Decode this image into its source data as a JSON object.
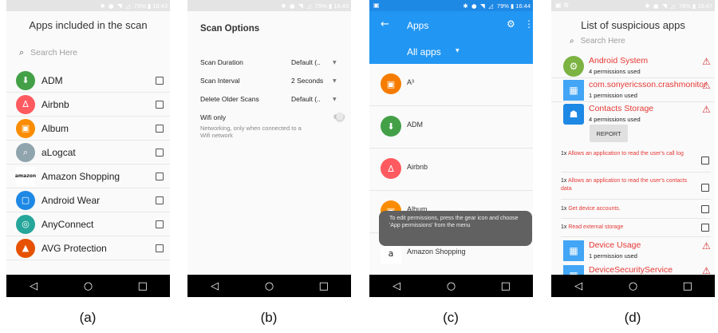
{
  "panel_a": {
    "status_text": "79% ▮ 16:43",
    "title": "Apps included in the scan",
    "search_placeholder": "Search Here",
    "apps": [
      {
        "name": "ADM",
        "color": "#43a047",
        "icon": "adm-icon",
        "glyph": "⬇"
      },
      {
        "name": "Airbnb",
        "color": "#ff5a5f",
        "icon": "airbnb-icon",
        "glyph": "∆"
      },
      {
        "name": "Album",
        "color": "#fb8c00",
        "icon": "album-icon",
        "glyph": "▣"
      },
      {
        "name": "aLogcat",
        "color": "#90a4ae",
        "icon": "alogcat-icon",
        "glyph": "⌕"
      },
      {
        "name": "Amazon Shopping",
        "color": "#ffffff",
        "icon": "amazon-icon",
        "glyph": "amazon"
      },
      {
        "name": "Android Wear",
        "color": "#1e88e5",
        "icon": "android-wear-icon",
        "glyph": "▢"
      },
      {
        "name": "AnyConnect",
        "color": "#26a69a",
        "icon": "anyconnect-icon",
        "glyph": "◎"
      },
      {
        "name": "AVG Protection",
        "color": "#e65100",
        "icon": "avg-icon",
        "glyph": "▲"
      }
    ]
  },
  "panel_b": {
    "status_text": "79% ▮ 16:43",
    "title": "Scan Options",
    "rows": [
      {
        "label": "Scan Duration",
        "value": "Default (.."
      },
      {
        "label": "Scan Interval",
        "value": "2 Seconds"
      },
      {
        "label": "Delete Older Scans",
        "value": "Default (.."
      }
    ],
    "wifi_label": "Wifi only",
    "wifi_desc": "Networking, only when connected to a Wifi network"
  },
  "panel_c": {
    "status_text": "79% ▮ 16:44",
    "title": "Apps",
    "filter": "All apps",
    "apps": [
      {
        "name": "A³",
        "color": "#f57c00",
        "icon": "a3-icon"
      },
      {
        "name": "ADM",
        "color": "#43a047",
        "icon": "adm-icon"
      },
      {
        "name": "Airbnb",
        "color": "#ff5a5f",
        "icon": "airbnb-icon"
      },
      {
        "name": "Album",
        "color": "#fb8c00",
        "icon": "album-icon"
      },
      {
        "name": "Amazon Shopping",
        "color": "#ffffff",
        "icon": "amazon-icon"
      }
    ],
    "toast": "To edit permissions, press the gear icon and choose 'App permissions' from the menu"
  },
  "panel_d": {
    "status_text": "78% ▮ 16:47",
    "title": "List of suspicious apps",
    "search_placeholder": "Search Here",
    "apps": [
      {
        "name": "Android System",
        "sub": "4 permissions used",
        "color": "#7cb342",
        "icon": "android-system-icon"
      },
      {
        "name": "com.sonyericsson.crashmonitor",
        "sub": "1 permission used",
        "color": "#42a5f5",
        "icon": "crashmonitor-icon"
      },
      {
        "name": "Contacts Storage",
        "sub": "4 permissions used",
        "color": "#1e88e5",
        "icon": "contacts-storage-icon"
      }
    ],
    "report": "REPORT",
    "permissions": [
      {
        "count": "1x",
        "text": "Allows an application to read the user's call log"
      },
      {
        "count": "1x",
        "text": "Allows an application to read the user's contacts data"
      },
      {
        "count": "1x",
        "text": "Get device accounts."
      },
      {
        "count": "1x",
        "text": "Read external storage"
      }
    ],
    "device_usage": {
      "name": "Device Usage",
      "sub": "1 permission used"
    },
    "partial_app": "DeviceSecurityService"
  },
  "captions": [
    "(a)",
    "(b)",
    "(c)",
    "(d)"
  ]
}
